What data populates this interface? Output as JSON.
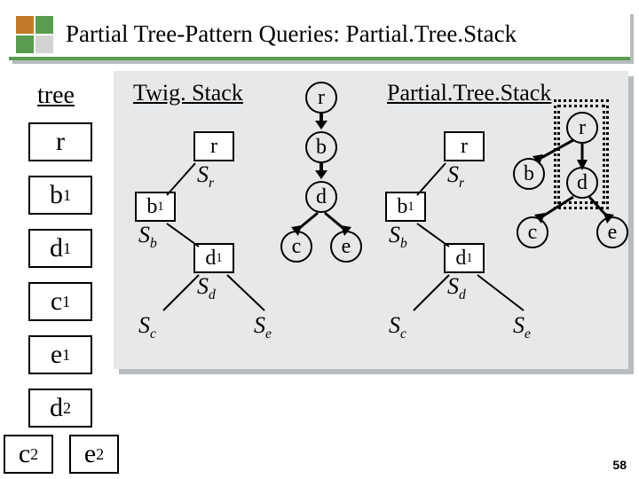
{
  "header": {
    "title": "Partial Tree-Pattern Queries: Partial.Tree.Stack"
  },
  "pagenum": "58",
  "labels": {
    "tree": "tree",
    "twigstack": "Twig. Stack",
    "partialtreestack": "Partial.Tree.Stack"
  },
  "leftnodes": [
    "r",
    "b",
    "d",
    "c",
    "e",
    "d"
  ],
  "leftsubs": [
    "",
    "1",
    "1",
    "1",
    "1",
    "2"
  ],
  "c2": {
    "text": "c",
    "sub": "2"
  },
  "e2": {
    "text": "e",
    "sub": "2"
  },
  "twig": {
    "r": {
      "cell": "r",
      "lbl": "S",
      "lblsub": "r"
    },
    "b": {
      "cell": "b",
      "cellsub": "1",
      "lbl": "S",
      "lblsub": "b"
    },
    "d": {
      "cell": "d",
      "cellsub": "1",
      "lbl": "S",
      "lblsub": "d"
    },
    "sc": {
      "lbl": "S",
      "lblsub": "c"
    },
    "se": {
      "lbl": "S",
      "lblsub": "e"
    }
  },
  "query": {
    "r": "r",
    "b": "b",
    "d": "d",
    "c": "c",
    "e": "e"
  },
  "pts": {
    "r": {
      "cell": "r",
      "lbl": "S",
      "lblsub": "r"
    },
    "b": {
      "cell": "b",
      "cellsub": "1",
      "lbl": "S",
      "lblsub": "b"
    },
    "d": {
      "cell": "d",
      "cellsub": "1",
      "lbl": "S",
      "lblsub": "d"
    },
    "sc": {
      "lbl": "S",
      "lblsub": "c"
    },
    "se": {
      "lbl": "S",
      "lblsub": "e"
    }
  },
  "ptsquery": {
    "r": "r",
    "b": "b",
    "d": "d",
    "c": "c",
    "e": "e"
  }
}
